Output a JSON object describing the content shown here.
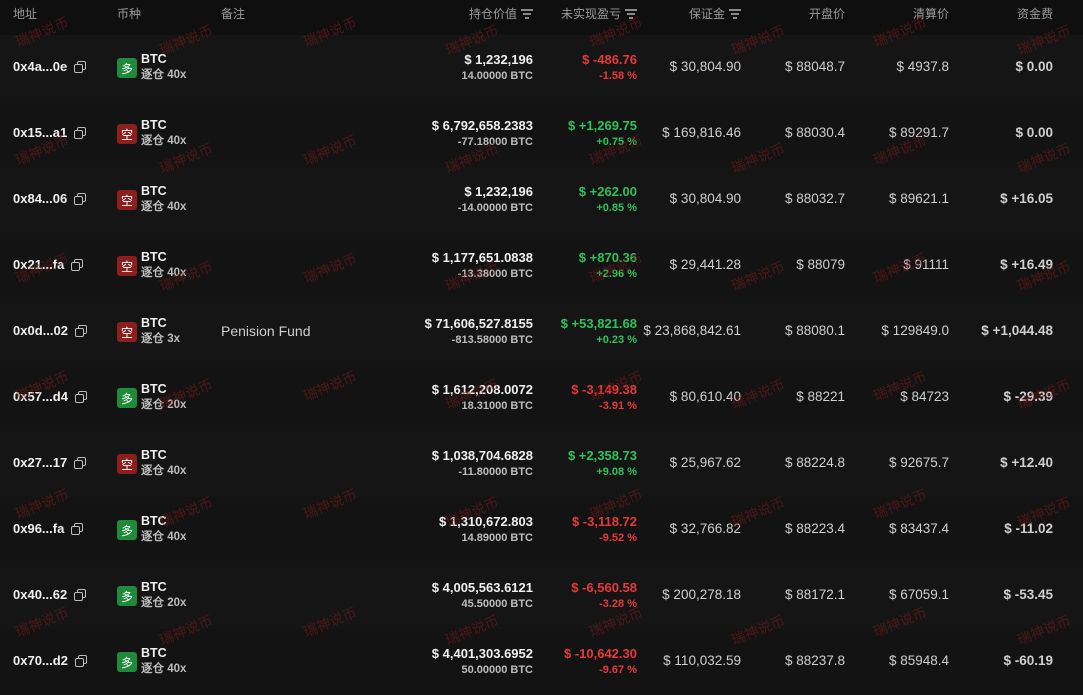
{
  "headers": {
    "address": "地址",
    "coin": "币种",
    "note": "备注",
    "value": "持仓价值",
    "pnl": "未实现盈亏",
    "margin": "保证金",
    "open": "开盘价",
    "liq": "清算价",
    "funding": "资金费"
  },
  "watermark": "瑞神说币",
  "rows": [
    {
      "address": "0x4a...0e",
      "side": "多",
      "side_type": "long",
      "coin": "BTC",
      "leverage": "逐仓 40x",
      "note": "",
      "value": "$ 1,232,196",
      "size": "14.00000 BTC",
      "pnl": "$ -486.76",
      "pnl_pct": "-1.58 %",
      "pnl_dir": "neg",
      "margin": "$ 30,804.90",
      "open": "$ 88048.7",
      "liq": "$ 4937.8",
      "funding": "$ 0.00",
      "fund_dir": "zero"
    },
    {
      "address": "0x15...a1",
      "side": "空",
      "side_type": "short",
      "coin": "BTC",
      "leverage": "逐仓 40x",
      "note": "",
      "value": "$ 6,792,658.2383",
      "size": "-77.18000 BTC",
      "pnl": "$ +1,269.75",
      "pnl_pct": "+0.75 %",
      "pnl_dir": "pos",
      "margin": "$ 169,816.46",
      "open": "$ 88030.4",
      "liq": "$ 89291.7",
      "funding": "$ 0.00",
      "fund_dir": "zero"
    },
    {
      "address": "0x84...06",
      "side": "空",
      "side_type": "short",
      "coin": "BTC",
      "leverage": "逐仓 40x",
      "note": "",
      "value": "$ 1,232,196",
      "size": "-14.00000 BTC",
      "pnl": "$ +262.00",
      "pnl_pct": "+0.85 %",
      "pnl_dir": "pos",
      "margin": "$ 30,804.90",
      "open": "$ 88032.7",
      "liq": "$ 89621.1",
      "funding": "$ +16.05",
      "fund_dir": "pos"
    },
    {
      "address": "0x21...fa",
      "side": "空",
      "side_type": "short",
      "coin": "BTC",
      "leverage": "逐仓 40x",
      "note": "",
      "value": "$ 1,177,651.0838",
      "size": "-13.38000 BTC",
      "pnl": "$ +870.36",
      "pnl_pct": "+2.96 %",
      "pnl_dir": "pos",
      "margin": "$ 29,441.28",
      "open": "$ 88079",
      "liq": "$ 91111",
      "funding": "$ +16.49",
      "fund_dir": "pos"
    },
    {
      "address": "0x0d...02",
      "side": "空",
      "side_type": "short",
      "coin": "BTC",
      "leverage": "逐仓 3x",
      "note": "Penision Fund",
      "value": "$ 71,606,527.8155",
      "size": "-813.58000 BTC",
      "pnl": "$ +53,821.68",
      "pnl_pct": "+0.23 %",
      "pnl_dir": "pos",
      "margin": "$ 23,868,842.61",
      "open": "$ 88080.1",
      "liq": "$ 129849.0",
      "funding": "$ +1,044.48",
      "fund_dir": "pos"
    },
    {
      "address": "0x57...d4",
      "side": "多",
      "side_type": "long",
      "coin": "BTC",
      "leverage": "逐仓 20x",
      "note": "",
      "value": "$ 1,612,208.0072",
      "size": "18.31000 BTC",
      "pnl": "$ -3,149.38",
      "pnl_pct": "-3.91 %",
      "pnl_dir": "neg",
      "margin": "$ 80,610.40",
      "open": "$ 88221",
      "liq": "$ 84723",
      "funding": "$ -29.39",
      "fund_dir": "neg"
    },
    {
      "address": "0x27...17",
      "side": "空",
      "side_type": "short",
      "coin": "BTC",
      "leverage": "逐仓 40x",
      "note": "",
      "value": "$ 1,038,704.6828",
      "size": "-11.80000 BTC",
      "pnl": "$ +2,358.73",
      "pnl_pct": "+9.08 %",
      "pnl_dir": "pos",
      "margin": "$ 25,967.62",
      "open": "$ 88224.8",
      "liq": "$ 92675.7",
      "funding": "$ +12.40",
      "fund_dir": "pos"
    },
    {
      "address": "0x96...fa",
      "side": "多",
      "side_type": "long",
      "coin": "BTC",
      "leverage": "逐仓 40x",
      "note": "",
      "value": "$ 1,310,672.803",
      "size": "14.89000 BTC",
      "pnl": "$ -3,118.72",
      "pnl_pct": "-9.52 %",
      "pnl_dir": "neg",
      "margin": "$ 32,766.82",
      "open": "$ 88223.4",
      "liq": "$ 83437.4",
      "funding": "$ -11.02",
      "fund_dir": "neg"
    },
    {
      "address": "0x40...62",
      "side": "多",
      "side_type": "long",
      "coin": "BTC",
      "leverage": "逐仓 20x",
      "note": "",
      "value": "$ 4,005,563.6121",
      "size": "45.50000 BTC",
      "pnl": "$ -6,560.58",
      "pnl_pct": "-3.28 %",
      "pnl_dir": "neg",
      "margin": "$ 200,278.18",
      "open": "$ 88172.1",
      "liq": "$ 67059.1",
      "funding": "$ -53.45",
      "fund_dir": "neg"
    },
    {
      "address": "0x70...d2",
      "side": "多",
      "side_type": "long",
      "coin": "BTC",
      "leverage": "逐仓 40x",
      "note": "",
      "value": "$ 4,401,303.6952",
      "size": "50.00000 BTC",
      "pnl": "$ -10,642.30",
      "pnl_pct": "-9.67 %",
      "pnl_dir": "neg",
      "margin": "$ 110,032.59",
      "open": "$ 88237.8",
      "liq": "$ 85948.4",
      "funding": "$ -60.19",
      "fund_dir": "neg"
    }
  ]
}
